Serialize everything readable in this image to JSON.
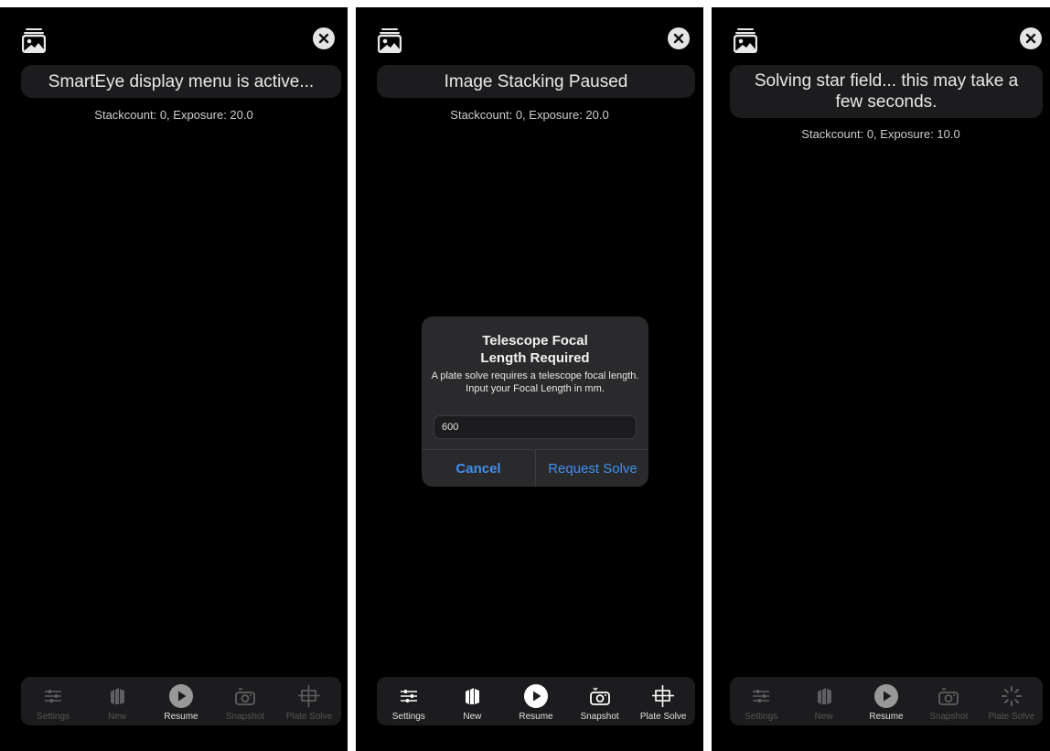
{
  "screens": [
    {
      "banner": "SmartEye display menu is active...",
      "stack_info": "Stackcount: 0, Exposure: 20.0",
      "toolbar_state": "disabled",
      "plate_solve_icon": "crosshair-icon"
    },
    {
      "banner": "Image Stacking Paused",
      "stack_info": "Stackcount: 0, Exposure: 20.0",
      "toolbar_state": "enabled",
      "plate_solve_icon": "crosshair-icon",
      "dialog": {
        "title_line1": "Telescope Focal",
        "title_line2": "Length Required",
        "message": "A plate solve requires a telescope focal length. Input your Focal Length in mm.",
        "input_value": "600",
        "cancel_label": "Cancel",
        "confirm_label": "Request Solve"
      }
    },
    {
      "banner": "Solving star field... this may take a few seconds.",
      "stack_info": "Stackcount: 0, Exposure: 10.0",
      "toolbar_state": "disabled",
      "plate_solve_icon": "spinner-icon"
    }
  ],
  "toolbar": {
    "settings_label": "Settings",
    "new_label": "New",
    "resume_label": "Resume",
    "snapshot_label": "Snapshot",
    "plate_solve_label": "Plate Solve"
  },
  "colors": {
    "background": "#000000",
    "panel": "#1c1c1e",
    "dialog": "#2a2a2c",
    "accent_blue": "#3f8ff0"
  }
}
